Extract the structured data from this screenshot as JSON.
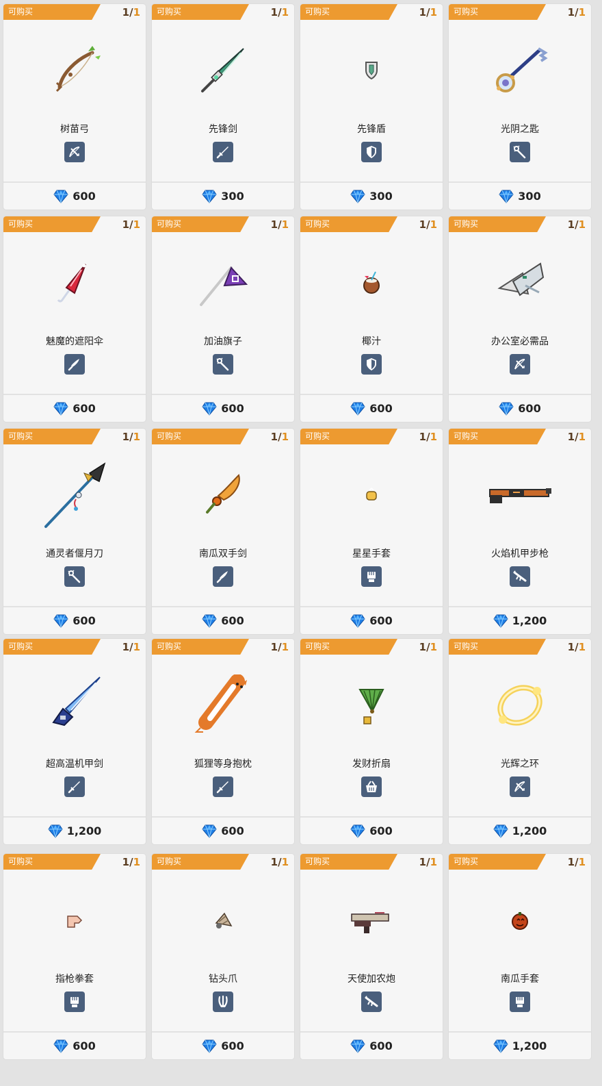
{
  "shop": {
    "tag_label": "可购买",
    "items": [
      {
        "name": "树苗弓",
        "stock": "1",
        "max": "1",
        "price": "600",
        "type_icon": "bow-icon",
        "art_icon": "sapling-bow-icon"
      },
      {
        "name": "先锋剑",
        "stock": "1",
        "max": "1",
        "price": "300",
        "type_icon": "sword-icon",
        "art_icon": "vanguard-sword-icon"
      },
      {
        "name": "先锋盾",
        "stock": "1",
        "max": "1",
        "price": "300",
        "type_icon": "shield-icon",
        "art_icon": "vanguard-shield-icon"
      },
      {
        "name": "光阴之匙",
        "stock": "1",
        "max": "1",
        "price": "300",
        "type_icon": "staff-icon",
        "art_icon": "time-key-icon"
      },
      {
        "name": "魅魔的遮阳伞",
        "stock": "1",
        "max": "1",
        "price": "600",
        "type_icon": "blade-icon",
        "art_icon": "parasol-icon"
      },
      {
        "name": "加油旗子",
        "stock": "1",
        "max": "1",
        "price": "600",
        "type_icon": "staff-icon",
        "art_icon": "cheer-flag-icon"
      },
      {
        "name": "椰汁",
        "stock": "1",
        "max": "1",
        "price": "600",
        "type_icon": "shield-icon",
        "art_icon": "coconut-icon"
      },
      {
        "name": "办公室必需品",
        "stock": "1",
        "max": "1",
        "price": "600",
        "type_icon": "bow-icon",
        "art_icon": "office-supplies-icon"
      },
      {
        "name": "通灵者偃月刀",
        "stock": "1",
        "max": "1",
        "price": "600",
        "type_icon": "staff-icon",
        "art_icon": "glaive-icon"
      },
      {
        "name": "南瓜双手剑",
        "stock": "1",
        "max": "1",
        "price": "600",
        "type_icon": "blade-icon",
        "art_icon": "pumpkin-greatsword-icon"
      },
      {
        "name": "星星手套",
        "stock": "1",
        "max": "1",
        "price": "600",
        "type_icon": "gauntlet-icon",
        "art_icon": "star-glove-icon"
      },
      {
        "name": "火焰机甲步枪",
        "stock": "1",
        "max": "1",
        "price": "1,200",
        "type_icon": "rifle-icon",
        "art_icon": "flame-mech-rifle-icon"
      },
      {
        "name": "超高温机甲剑",
        "stock": "1",
        "max": "1",
        "price": "1,200",
        "type_icon": "sword-icon",
        "art_icon": "mech-sword-icon"
      },
      {
        "name": "狐狸等身抱枕",
        "stock": "1",
        "max": "1",
        "price": "600",
        "type_icon": "sword-icon",
        "art_icon": "fox-pillow-icon"
      },
      {
        "name": "发财折扇",
        "stock": "1",
        "max": "1",
        "price": "600",
        "type_icon": "basket-icon",
        "art_icon": "fortune-fan-icon"
      },
      {
        "name": "光辉之环",
        "stock": "1",
        "max": "1",
        "price": "1,200",
        "type_icon": "bow-icon",
        "art_icon": "radiant-ring-icon"
      },
      {
        "name": "指枪拳套",
        "stock": "1",
        "max": "1",
        "price": "600",
        "type_icon": "gauntlet-icon",
        "art_icon": "finger-gun-glove-icon"
      },
      {
        "name": "钻头爪",
        "stock": "1",
        "max": "1",
        "price": "600",
        "type_icon": "claw-icon",
        "art_icon": "drill-claw-icon"
      },
      {
        "name": "天使加农炮",
        "stock": "1",
        "max": "1",
        "price": "600",
        "type_icon": "rifle-icon",
        "art_icon": "angel-cannon-icon"
      },
      {
        "name": "南瓜手套",
        "stock": "1",
        "max": "1",
        "price": "1,200",
        "type_icon": "gauntlet-icon",
        "art_icon": "pumpkin-glove-icon"
      }
    ],
    "colors": {
      "tag": "#ed9a30",
      "type_badge": "#4a5f7c",
      "gem": "#1f7fe6"
    }
  }
}
